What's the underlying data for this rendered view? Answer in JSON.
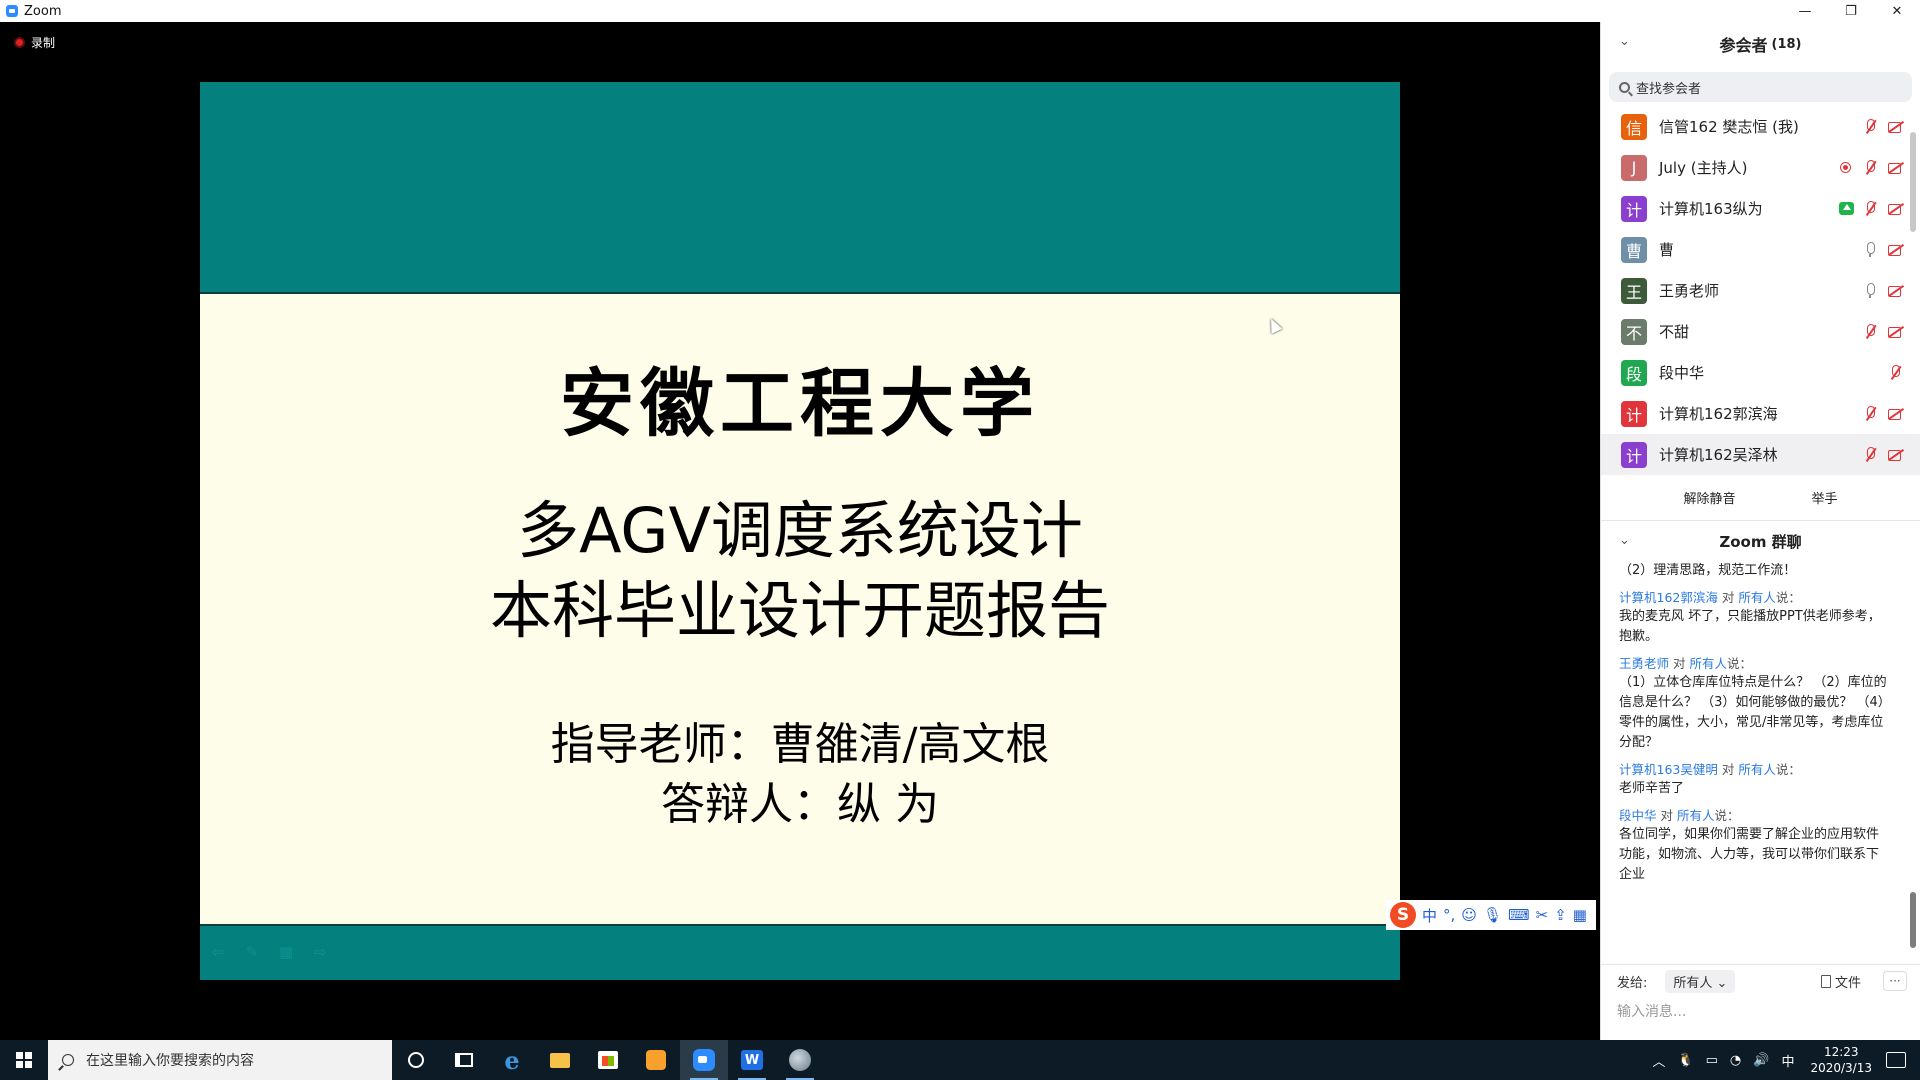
{
  "window": {
    "title": "Zoom",
    "controls": {
      "minimize": "—",
      "restore": "❐",
      "close": "✕"
    }
  },
  "recording": {
    "label": "录制"
  },
  "slide": {
    "university": "安徽工程大学",
    "title_line1": "多AGV调度系统设计",
    "title_line2": "本科毕业设计开题报告",
    "advisor": "指导老师：曹雒清/高文根",
    "defender": "答辩人：纵 为",
    "controls": [
      "⇦",
      "✎",
      "▦",
      "⇨"
    ]
  },
  "ime": {
    "logo": "S",
    "items": [
      "中",
      "°,",
      "☺",
      "🎙",
      "⌨",
      "✂",
      "⇪",
      "▦"
    ]
  },
  "participants_panel": {
    "chevron": "⌄",
    "title": "参会者",
    "count": "(18)",
    "search_placeholder": "查找参会者",
    "participants": [
      {
        "avatar_text": "信",
        "avatar_color": "#e8610c",
        "name": "信管162 樊志恒 (我)",
        "icons": [
          "mic-off",
          "cam-off"
        ]
      },
      {
        "avatar_text": "J",
        "avatar_color": "#c96b6b",
        "name": "July (主持人)",
        "icons": [
          "rec",
          "mic-off",
          "cam-off"
        ]
      },
      {
        "avatar_text": "计",
        "avatar_color": "#8b3fcf",
        "name": "计算机163纵为",
        "icons": [
          "share",
          "mic-off",
          "cam-off"
        ]
      },
      {
        "avatar_text": "曹",
        "avatar_color": "#6f8fa8",
        "name": "曹",
        "icons": [
          "mic",
          "cam-off"
        ]
      },
      {
        "avatar_text": "王",
        "avatar_color": "#3d5a3a",
        "name": "王勇老师",
        "icons": [
          "mic",
          "cam-off"
        ]
      },
      {
        "avatar_text": "不",
        "avatar_color": "#6b7d6a",
        "name": "不甜",
        "icons": [
          "mic-off",
          "cam-off"
        ]
      },
      {
        "avatar_text": "段",
        "avatar_color": "#1fa84f",
        "name": "段中华",
        "icons": [
          "mic-off"
        ]
      },
      {
        "avatar_text": "计",
        "avatar_color": "#e0353b",
        "name": "计算机162郭滨海",
        "icons": [
          "mic-off",
          "cam-off"
        ]
      },
      {
        "avatar_text": "计",
        "avatar_color": "#8b3fcf",
        "name": "计算机162吴泽林",
        "icons": [
          "mic-off",
          "cam-off"
        ]
      }
    ],
    "actions": {
      "unmute": "解除静音",
      "raise_hand": "举手"
    }
  },
  "chat": {
    "chevron": "⌄",
    "title": "Zoom 群聊",
    "messages": [
      {
        "who": "",
        "to": "",
        "suffix": "",
        "text": "（2）理清思路，规范工作流！"
      },
      {
        "who": "计算机162郭滨海",
        "to": "所有人",
        "suffix": "说：",
        "text": "我的麦克风 坏了，只能播放PPT供老师参考，抱歉。"
      },
      {
        "who": "王勇老师",
        "to": "所有人",
        "suffix": "说：",
        "text": "（1）立体仓库库位特点是什么？ （2）库位的信息是什么？ （3）如何能够做的最优？ （4）零件的属性，大小，常见/非常见等，考虑库位分配？"
      },
      {
        "who": "计算机163吴健明",
        "to": "所有人",
        "suffix": "说：",
        "text": "老师辛苦了"
      },
      {
        "who": "段中华",
        "to": "所有人",
        "suffix": "说：",
        "text": "各位同学，如果你们需要了解企业的应用软件功能，如物流、人力等，我可以带你们联系下企业"
      }
    ],
    "to_word": "对",
    "send_label": "发给:",
    "send_to": "所有人 ⌄",
    "file_label": "文件",
    "more_label": "···",
    "input_placeholder": "输入消息..."
  },
  "taskbar": {
    "search_placeholder": "在这里输入你要搜索的内容",
    "time": "12:23",
    "date": "2020/3/13",
    "tray": [
      "︿",
      "🐧",
      "▭",
      "◔",
      "🔊",
      "中"
    ],
    "apps": [
      "cortana",
      "task-view",
      "edge",
      "file-explorer",
      "store",
      "sogou",
      "zoom",
      "wps",
      "ppt"
    ]
  }
}
